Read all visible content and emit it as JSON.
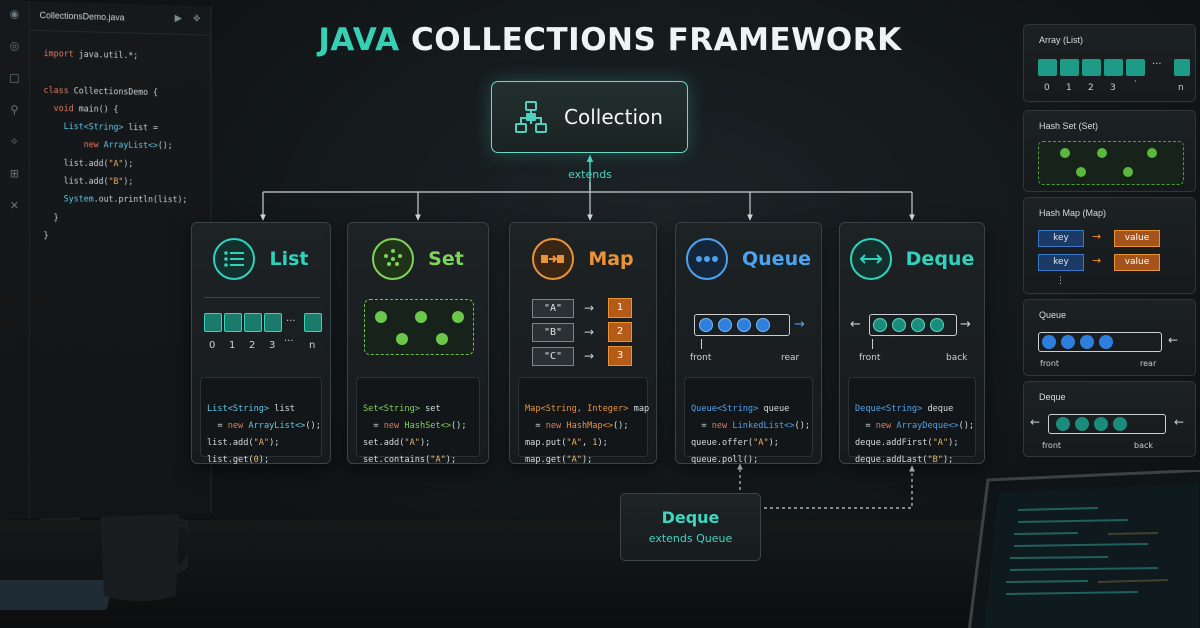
{
  "title": {
    "accent": "JAVA",
    "rest": "COLLECTIONS FRAMEWORK"
  },
  "editor": {
    "tab_label": "CollectionsDemo.java",
    "lines": [
      "import java.util.*;",
      "",
      "class CollectionsDemo {",
      "  void main() {",
      "    List<String> list =",
      "        new ArrayList<>();",
      "    list.add(\"A\");",
      "    list.add(\"B\");",
      "    System.out.println(list);",
      "  }",
      "}"
    ]
  },
  "root": {
    "label": "Collection",
    "extends": "extends"
  },
  "cards": [
    {
      "id": "list",
      "title": "List",
      "color": "#2fd3bd",
      "indices": [
        "0",
        "1",
        "2",
        "3",
        "···",
        "n"
      ],
      "code": [
        "List<String> list",
        "  = new ArrayList<>();",
        "list.add(\"A\");",
        "list.get(0);"
      ]
    },
    {
      "id": "set",
      "title": "Set",
      "color": "#7fd35a",
      "code": [
        "Set<String> set",
        "  = new HashSet<>();",
        "set.add(\"A\");",
        "set.contains(\"A\");"
      ]
    },
    {
      "id": "map",
      "title": "Map",
      "color": "#e9933a",
      "keys": [
        "\"A\"",
        "\"B\"",
        "\"C\""
      ],
      "values": [
        "1",
        "2",
        "3"
      ],
      "code": [
        "Map<String, Integer> map",
        "  = new HashMap<>();",
        "map.put(\"A\", 1);",
        "map.get(\"A\");"
      ]
    },
    {
      "id": "queue",
      "title": "Queue",
      "color": "#4da3ef",
      "front": "front",
      "rear": "rear",
      "code": [
        "Queue<String> queue",
        "  = new LinkedList<>();",
        "queue.offer(\"A\");",
        "queue.poll();"
      ]
    },
    {
      "id": "deque",
      "title": "Deque",
      "color": "#2fd3bd",
      "front": "front",
      "back": "back",
      "code": [
        "Deque<String> deque",
        "  = new ArrayDeque<>();",
        "deque.addFirst(\"A\");",
        "deque.addLast(\"B\");"
      ]
    }
  ],
  "deque_extends": {
    "title": "Deque",
    "subtitle": "extends Queue"
  },
  "right_panel": {
    "array": {
      "title": "Array (List)",
      "indices": [
        "0",
        "1",
        "2",
        "3",
        "·",
        "n"
      ],
      "ellipsis": "···"
    },
    "hashset": {
      "title": "Hash Set (Set)"
    },
    "hashmap": {
      "title": "Hash Map (Map)",
      "key": "key",
      "value": "value",
      "more": "⋮"
    },
    "queue": {
      "title": "Queue",
      "front": "front",
      "rear": "rear"
    },
    "deque": {
      "title": "Deque",
      "front": "front",
      "back": "back"
    }
  },
  "colors": {
    "teal": "#2fd3bd",
    "green": "#7fd35a",
    "orange": "#e9933a",
    "blue": "#4da3ef"
  }
}
